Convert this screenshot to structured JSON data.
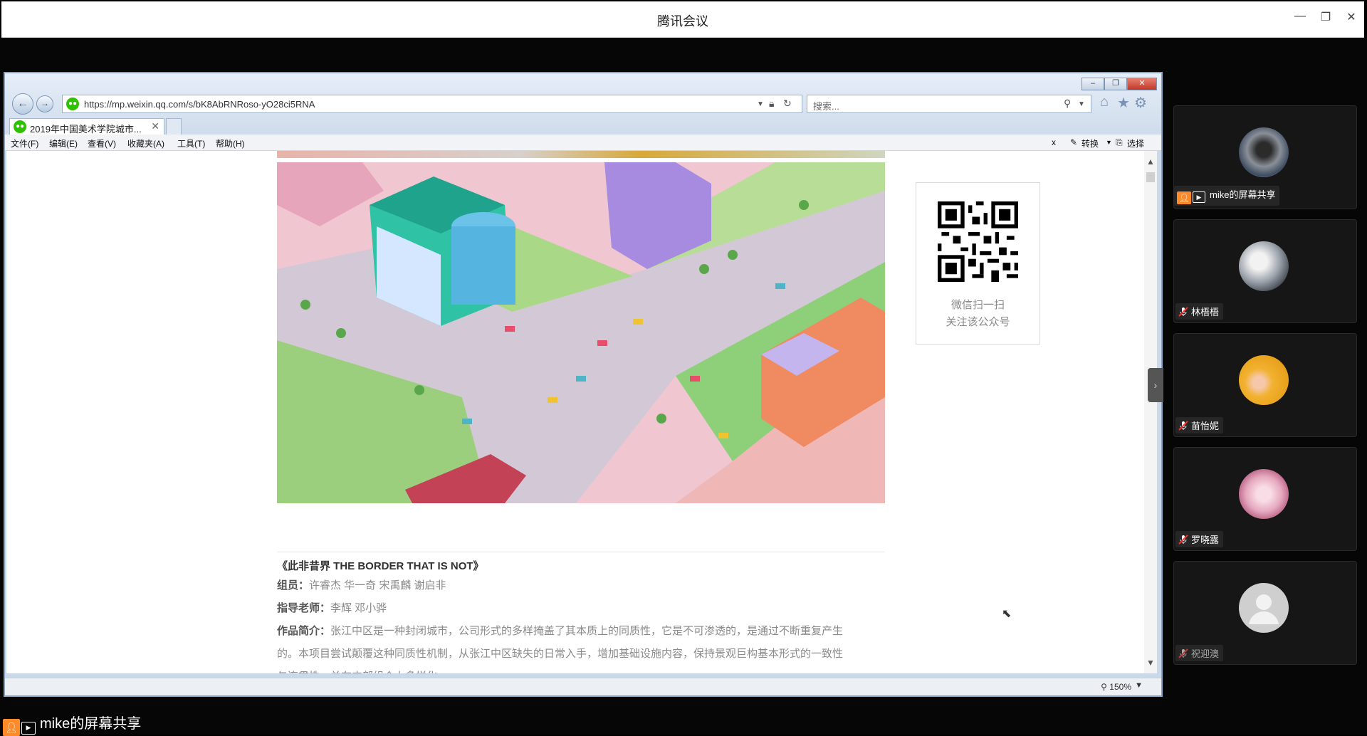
{
  "window": {
    "title": "腾讯会议",
    "minimize": "—",
    "restore": "❐",
    "close": "✕"
  },
  "browser": {
    "url": "https://mp.weixin.qq.com/s/bK8AbRNRoso-yO28ci5RNA",
    "search_placeholder": "搜索...",
    "tab_label": "2019年中国美术学院城市...",
    "tab_close": "✕",
    "menu": [
      "文件(F)",
      "编辑(E)",
      "查看(V)",
      "收藏夹(A)",
      "工具(T)",
      "帮助(H)"
    ],
    "toolbar_right": {
      "close": "x",
      "convert": "转换",
      "select": "选择"
    },
    "zoom": "150%"
  },
  "article": {
    "qr_caption_1": "微信扫一扫",
    "qr_caption_2": "关注该公众号",
    "title": "《此非昔界 THE BORDER THAT IS NOT》",
    "members_label": "组员：",
    "members": "许睿杰   华一奇   宋禹麟   谢启非",
    "advisors_label": "指导老师：",
    "advisors": "李辉   邓小骅",
    "intro_label": "作品简介：",
    "intro_1": "张江中区是一种封闭城市，公司形式的多样掩盖了其本质上的同质性，它是不可渗透的，是通过不断重复产生",
    "intro_2": "的。本项目尝试颠覆这种同质性机制，从张江中区缺失的日常入手，增加基础设施内容，保持景观巨构基本形式的一致性",
    "intro_3": "与连贯性，并在内部组合上多样化。"
  },
  "participants": [
    {
      "name": "mike的屏幕共享",
      "sharing": true,
      "avatar": "astronaut"
    },
    {
      "name": "林梧梧",
      "sharing": false,
      "avatar": "anime-sketch"
    },
    {
      "name": "苗怡妮",
      "sharing": false,
      "avatar": "yellow-duck"
    },
    {
      "name": "罗晓露",
      "sharing": false,
      "avatar": "anime-pink"
    },
    {
      "name": "祝迎澳",
      "sharing": false,
      "avatar": "default-person"
    }
  ],
  "share_label": "mike的屏幕共享",
  "colors": {
    "accent": "#ff8a2a",
    "wechat": "#2dc100",
    "mic_muted": "#e53935"
  }
}
